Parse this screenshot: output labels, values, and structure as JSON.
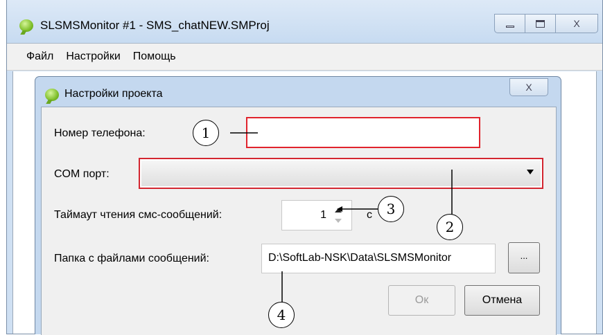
{
  "window": {
    "title": "SLSMSMonitor #1 - SMS_chatNEW.SMProj",
    "min_glyph": "",
    "max_glyph": "",
    "close_glyph": "X"
  },
  "menu": {
    "file": "Файл",
    "settings": "Настройки",
    "help": "Помощь"
  },
  "dialog": {
    "title": "Настройки проекта",
    "close_glyph": "X",
    "phone_label": "Номер телефона:",
    "phone_value": "",
    "com_label": "COM порт:",
    "com_value": "",
    "timeout_label": "Таймаут чтения смс-сообщений:",
    "timeout_value": "1",
    "timeout_unit": "с",
    "folder_label": "Папка с файлами сообщений:",
    "folder_value": "D:\\SoftLab-NSK\\Data\\SLSMSMonitor",
    "browse_label": "...",
    "ok_label": "Ок",
    "cancel_label": "Отмена"
  },
  "callouts": [
    "1",
    "2",
    "3",
    "4"
  ]
}
